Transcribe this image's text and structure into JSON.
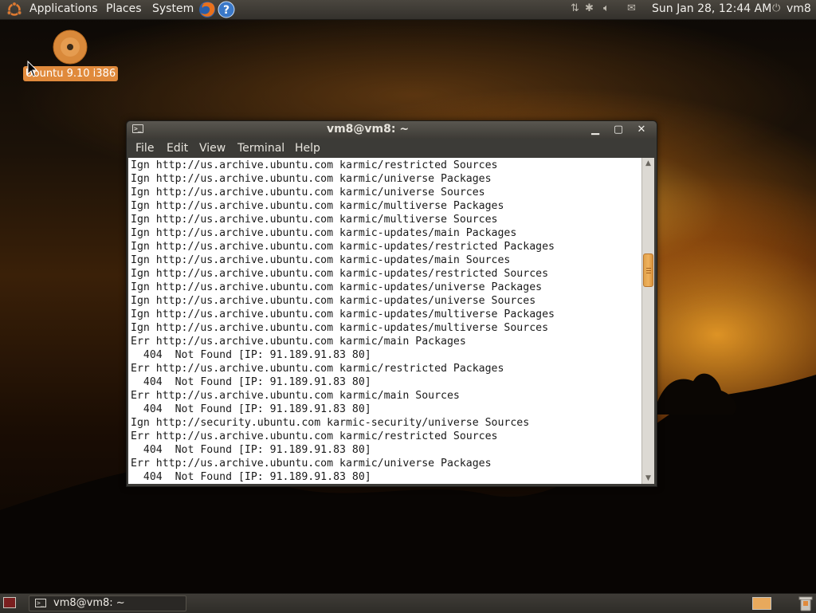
{
  "top_panel": {
    "menus": [
      "Applications",
      "Places",
      "System"
    ],
    "datetime": "Sun Jan 28, 12:44 AM",
    "user": "vm8"
  },
  "desktop": {
    "icon_label": "Ubuntu 9.10 i386"
  },
  "window": {
    "title": "vm8@vm8: ~",
    "menu": [
      "File",
      "Edit",
      "View",
      "Terminal",
      "Help"
    ],
    "lines": [
      "Ign http://us.archive.ubuntu.com karmic/restricted Sources",
      "Ign http://us.archive.ubuntu.com karmic/universe Packages",
      "Ign http://us.archive.ubuntu.com karmic/universe Sources",
      "Ign http://us.archive.ubuntu.com karmic/multiverse Packages",
      "Ign http://us.archive.ubuntu.com karmic/multiverse Sources",
      "Ign http://us.archive.ubuntu.com karmic-updates/main Packages",
      "Ign http://us.archive.ubuntu.com karmic-updates/restricted Packages",
      "Ign http://us.archive.ubuntu.com karmic-updates/main Sources",
      "Ign http://us.archive.ubuntu.com karmic-updates/restricted Sources",
      "Ign http://us.archive.ubuntu.com karmic-updates/universe Packages",
      "Ign http://us.archive.ubuntu.com karmic-updates/universe Sources",
      "Ign http://us.archive.ubuntu.com karmic-updates/multiverse Packages",
      "Ign http://us.archive.ubuntu.com karmic-updates/multiverse Sources",
      "Err http://us.archive.ubuntu.com karmic/main Packages",
      "  404  Not Found [IP: 91.189.91.83 80]",
      "Err http://us.archive.ubuntu.com karmic/restricted Packages",
      "  404  Not Found [IP: 91.189.91.83 80]",
      "Err http://us.archive.ubuntu.com karmic/main Sources",
      "  404  Not Found [IP: 91.189.91.83 80]",
      "Ign http://security.ubuntu.com karmic-security/universe Sources",
      "Err http://us.archive.ubuntu.com karmic/restricted Sources",
      "  404  Not Found [IP: 91.189.91.83 80]",
      "Err http://us.archive.ubuntu.com karmic/universe Packages",
      "  404  Not Found [IP: 91.189.91.83 80]"
    ]
  },
  "taskbar": {
    "task_label": "vm8@vm8: ~"
  },
  "colors": {
    "accent": "#e08a3c",
    "panel": "#3c3b37"
  }
}
